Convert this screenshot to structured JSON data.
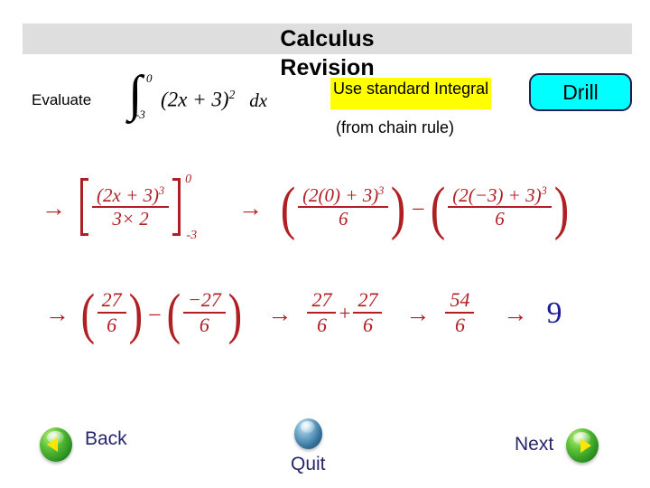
{
  "header": {
    "title_line1": "Calculus",
    "title_line2": "Revision"
  },
  "problem": {
    "evaluate_label": "Evaluate",
    "integral": {
      "upper_limit": "0",
      "lower_limit": "-3",
      "integrand_base": "(2x + 3)",
      "integrand_power": "2",
      "differential": "dx"
    }
  },
  "hints": {
    "highlight_text": "Use standard Integral",
    "sub_text": "(from chain rule)",
    "highlight_color": "#ffff00"
  },
  "drill": {
    "label": "Drill",
    "fill_color": "#00ffff",
    "border_color": "#1f1f4f"
  },
  "working": {
    "arrow": "→",
    "minus": "–",
    "plus": "+",
    "paren_open": "(",
    "paren_close": ")",
    "row2": {
      "bracket_numerator_base": "(2x + 3)",
      "bracket_numerator_power": "3",
      "bracket_denominator": "3× 2",
      "bracket_upper_limit": "0",
      "bracket_lower_limit": "-3",
      "term1_numerator_base": "(2(0) + 3)",
      "term1_numerator_power": "3",
      "term1_denominator": "6",
      "term2_numerator_base": "(2(−3) + 3)",
      "term2_numerator_power": "3",
      "term2_denominator": "6"
    },
    "row3": {
      "t1_num": "27",
      "t1_den": "6",
      "t2_num": "−27",
      "t2_den": "6",
      "t3_num": "27",
      "t3_den": "6",
      "t4_num": "27",
      "t4_den": "6",
      "t5_num": "54",
      "t5_den": "6",
      "answer": "9"
    },
    "text_color": "#b01f24",
    "answer_color": "#1b1b96"
  },
  "nav": {
    "back_label": "Back",
    "quit_label": "Quit",
    "next_label": "Next"
  }
}
